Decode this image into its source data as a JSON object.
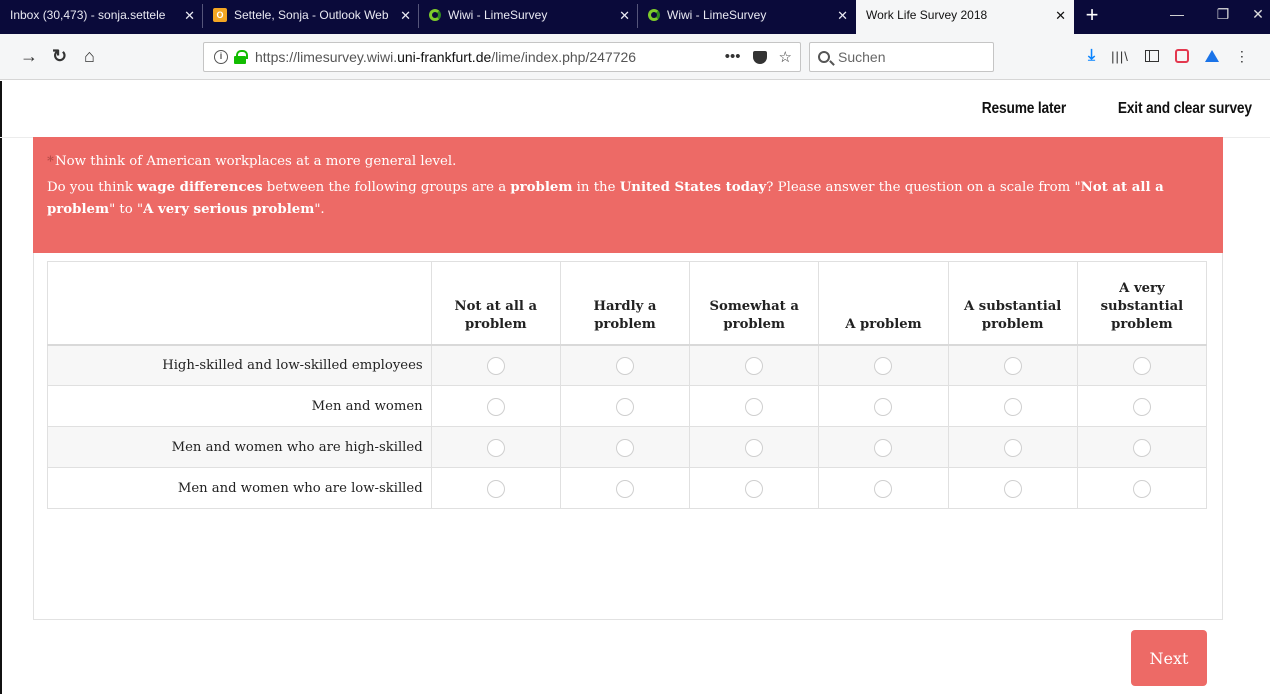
{
  "tabs": [
    {
      "title": "Inbox (30,473) - sonja.settele",
      "icon": "none",
      "active": false
    },
    {
      "title": "Settele, Sonja - Outlook Web",
      "icon": "outlook",
      "active": false
    },
    {
      "title": "Wiwi - LimeSurvey",
      "icon": "lime",
      "active": false
    },
    {
      "title": "Wiwi - LimeSurvey",
      "icon": "lime",
      "active": false
    },
    {
      "title": "Work Life Survey 2018",
      "icon": "none",
      "active": true
    }
  ],
  "url": {
    "prefix": "https://limesurvey.wiwi.",
    "domain": "uni-frankfurt.de",
    "suffix": "/lime/index.php/247726"
  },
  "search": {
    "placeholder": "Suchen"
  },
  "survey_nav": {
    "resume": "Resume later",
    "exit": "Exit and clear survey"
  },
  "question": {
    "mandatory_mark": "*",
    "line1": "Now think of American workplaces at a more general level.",
    "line2_parts": [
      {
        "text": "Do you think ",
        "bold": false
      },
      {
        "text": "wage differences",
        "bold": true
      },
      {
        "text": " between the following groups are a ",
        "bold": false
      },
      {
        "text": "problem",
        "bold": true
      },
      {
        "text": " in the ",
        "bold": false
      },
      {
        "text": "United States today",
        "bold": true
      },
      {
        "text": "? Please answer the question on a scale from \"",
        "bold": false
      },
      {
        "text": "Not at all a problem",
        "bold": true
      },
      {
        "text": "\" to \"",
        "bold": false
      },
      {
        "text": "A very serious problem",
        "bold": true
      },
      {
        "text": "\".",
        "bold": false
      }
    ]
  },
  "grid": {
    "columns": [
      "Not at all a problem",
      "Hardly a problem",
      "Somewhat a problem",
      "A problem",
      "A substantial problem",
      "A very substantial problem"
    ],
    "rows": [
      "High-skilled and low-skilled employees",
      "Men and women",
      "Men and women who are high-skilled",
      "Men and women who are low-skilled"
    ]
  },
  "next_label": "Next",
  "colors": {
    "accent": "#ed6a66"
  }
}
